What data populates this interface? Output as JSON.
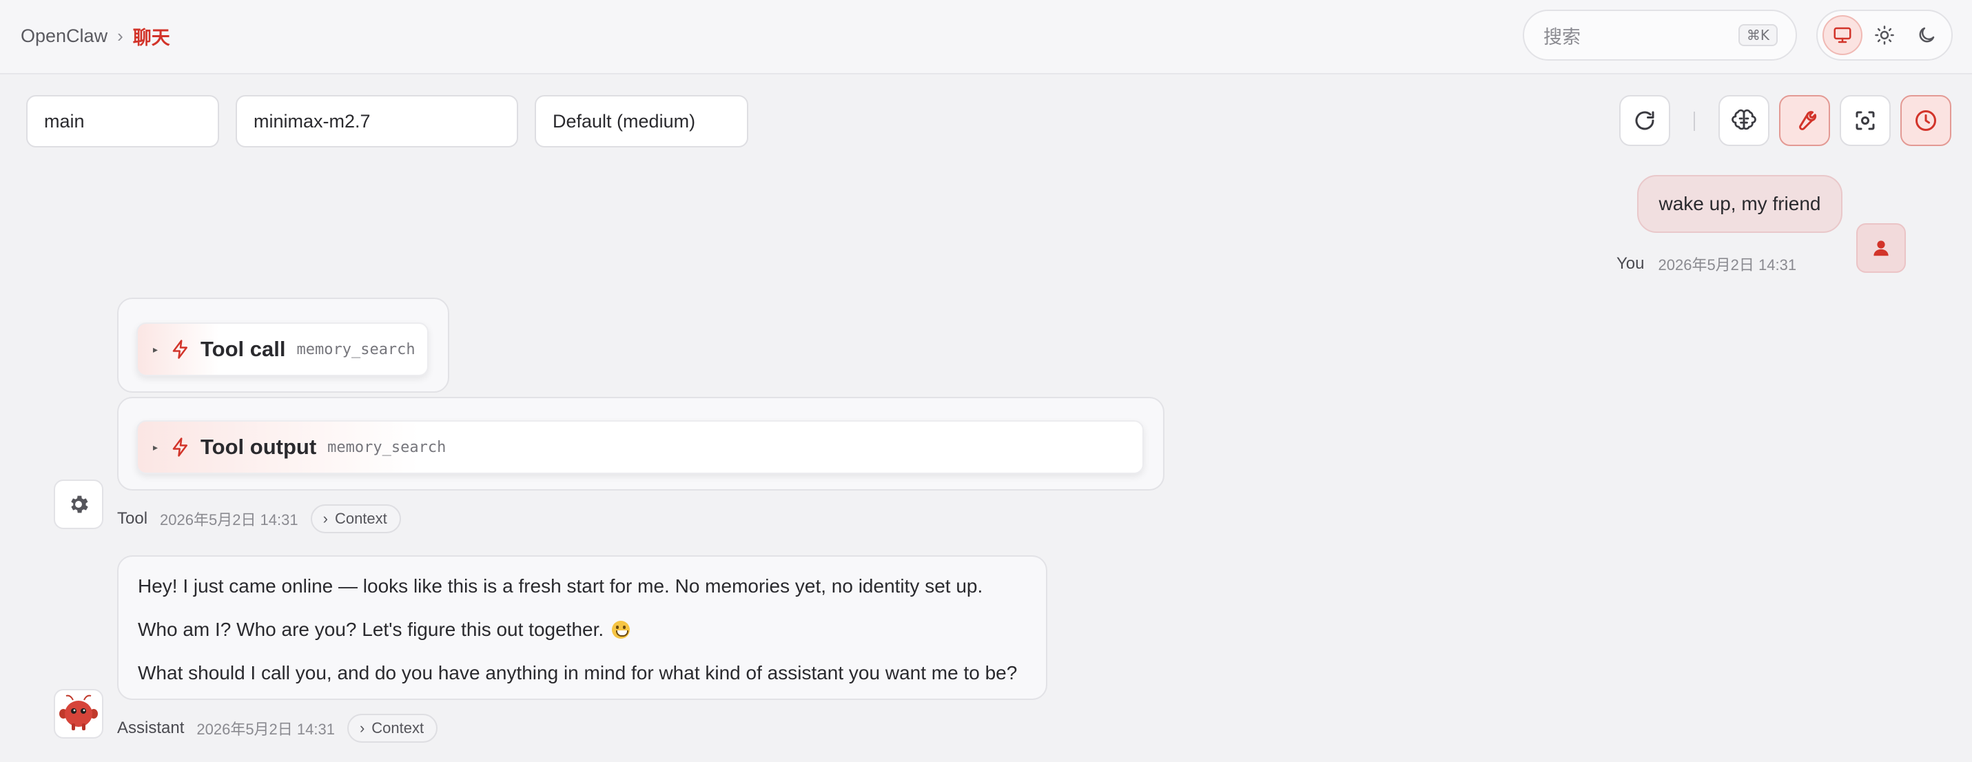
{
  "header": {
    "breadcrumb_root": "OpenClaw",
    "breadcrumb_separator": "›",
    "breadcrumb_current": "聊天",
    "search_placeholder": "搜索",
    "search_shortcut": "⌘K",
    "theme_options": [
      "system-monitor-icon",
      "sun-icon",
      "moon-icon"
    ],
    "active_theme": "system"
  },
  "controls": {
    "agent": "main",
    "model": "minimax-m2.7",
    "thinking_level": "Default (medium)",
    "separator": "|",
    "buttons": [
      "refresh-icon",
      "brain-icon",
      "wrench-icon",
      "focus-icon",
      "clock-icon"
    ]
  },
  "messages": {
    "user": {
      "text": "wake up, my friend",
      "sender": "You",
      "time": "2026年5月2日 14:31"
    },
    "tool": {
      "call_label": "Tool call",
      "call_name": "memory_search",
      "output_label": "Tool output",
      "output_name": "memory_search",
      "sender": "Tool",
      "time": "2026年5月2日 14:31",
      "context_label": "Context"
    },
    "assistant": {
      "paragraphs": [
        "Hey! I just came online — looks like this is a fresh start for me. No memories yet, no identity set up.",
        "Who am I? Who are you? Let's figure this out together.",
        "What should I call you, and do you have anything in mind for what kind of assistant you want me to be?"
      ],
      "sender": "Assistant",
      "time": "2026年5月2日 14:31",
      "context_label": "Context"
    }
  },
  "colors": {
    "accent": "#d2342a",
    "accent_soft": "#fbe3e1",
    "background": "#f2f2f4",
    "user_bubble": "#f1dfe0"
  }
}
